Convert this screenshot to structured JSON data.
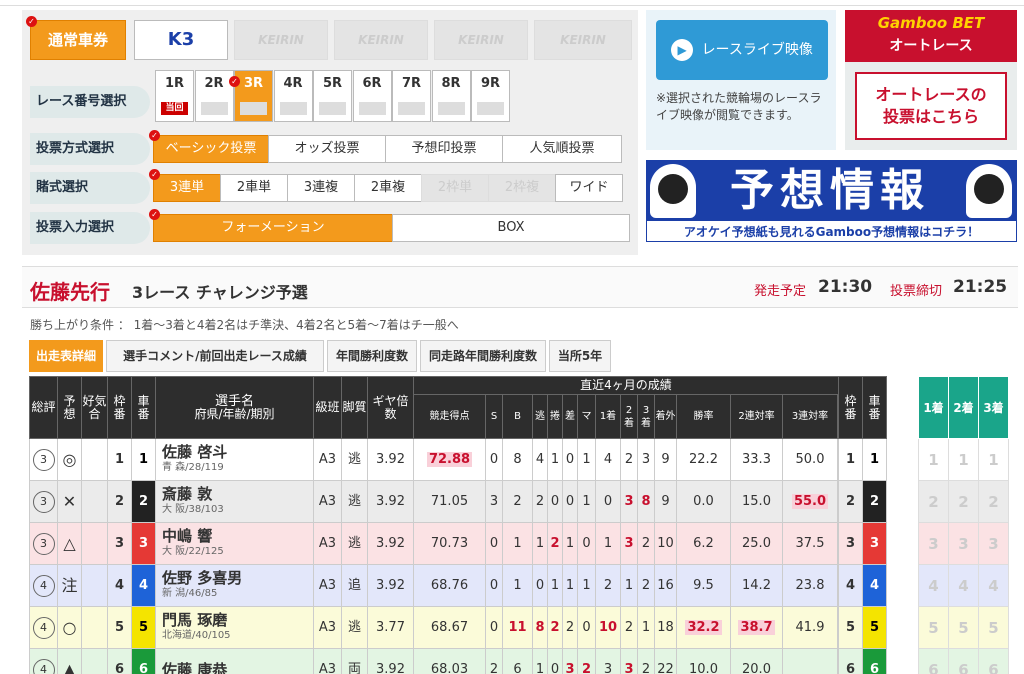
{
  "ticket_type": {
    "normal": "通常車券",
    "k3": "K3",
    "keirin": [
      "KEIRIN",
      "KEIRIN",
      "KEIRIN",
      "KEIRIN"
    ]
  },
  "rows": {
    "race_no": "レース番号選択",
    "vote_method": "投票方式選択",
    "bet_type": "賭式選択",
    "input_method": "投票入力選択"
  },
  "races": [
    {
      "label": "1R",
      "sub": "当回"
    },
    {
      "label": "2R",
      "sub": ""
    },
    {
      "label": "3R",
      "sub": ""
    },
    {
      "label": "4R",
      "sub": ""
    },
    {
      "label": "5R",
      "sub": ""
    },
    {
      "label": "6R",
      "sub": ""
    },
    {
      "label": "7R",
      "sub": ""
    },
    {
      "label": "8R",
      "sub": ""
    },
    {
      "label": "9R",
      "sub": ""
    }
  ],
  "vote_methods": [
    "ベーシック投票",
    "オッズ投票",
    "予想印投票",
    "人気順投票"
  ],
  "bet_types": [
    "3連単",
    "2車単",
    "3連複",
    "2車複",
    "2枠単",
    "2枠複",
    "ワイド"
  ],
  "input_methods": [
    "フォーメーション",
    "BOX"
  ],
  "live": {
    "button": "レースライブ映像",
    "note": "※選択された競輪場のレースライブ映像が閲覧できます。"
  },
  "autorace": {
    "brand": "Gamboo BET",
    "title": "オートレース",
    "cta_line1": "オートレースの",
    "cta_line2": "投票はこちら"
  },
  "yoso": {
    "title": "予想情報",
    "sub": "アオケイ予想紙も見れるGamboo予想情報はコチラ！"
  },
  "race": {
    "venue": "佐藤先行",
    "name": "3レース チャレンジ予選",
    "start_label": "発走予定",
    "start_time": "21:30",
    "close_label": "投票締切",
    "close_time": "21:25",
    "condition": "勝ち上がり条件 ： 1着〜3着と4着2名はチ準決、4着2名と5着〜7着はチ一般へ"
  },
  "tabs": [
    "出走表詳細",
    "選手コメント/前回出走レース成績",
    "年間勝利度数",
    "同走路年間勝利度数",
    "当所5年"
  ],
  "table_headers": {
    "sou": "総評",
    "yoso": "予想",
    "kouki": "好気合",
    "waku": "枠番",
    "sha": "車番",
    "name": "選手名",
    "name_sub": "府県/年齢/期別",
    "kyu": "級班",
    "kyaku": "脚質",
    "gear": "ギヤ倍数",
    "recent": "直近4ヶ月の成績",
    "score": "競走得点",
    "s": "S",
    "b": "B",
    "nige": "逃",
    "makuri": "捲",
    "sashi": "差",
    "ma": "マ",
    "c1": "1着",
    "c2": "2着",
    "c3": "3着",
    "out": "着外",
    "win": "勝率",
    "ren2": "2連対率",
    "ren3": "3連対率",
    "res1": "1着",
    "res2": "2着",
    "res3": "3着"
  },
  "riders": [
    {
      "sou": "3",
      "mark": "◎",
      "waku": "1",
      "sha": "1",
      "name": "佐藤 啓斗",
      "info": "青 森/28/119",
      "kyu": "A3",
      "kyaku": "逃",
      "gear": "3.92",
      "score": "72.88",
      "s": "0",
      "b": "8",
      "nige": "4",
      "makuri": "1",
      "sashi": "0",
      "ma": "1",
      "c1": "4",
      "c2": "2",
      "c3": "3",
      "out": "9",
      "win": "22.2",
      "ren2": "33.3",
      "ren3": "50.0",
      "row": "#ffffff",
      "shaBg": "#ffffff",
      "shaFg": "#000000"
    },
    {
      "sou": "3",
      "mark": "✕",
      "waku": "2",
      "sha": "2",
      "name": "斎藤 敦",
      "info": "大 阪/38/103",
      "kyu": "A3",
      "kyaku": "逃",
      "gear": "3.92",
      "score": "71.05",
      "s": "3",
      "b": "2",
      "nige": "2",
      "makuri": "0",
      "sashi": "0",
      "ma": "1",
      "c1": "0",
      "c2": "3",
      "c3": "8",
      "out": "9",
      "win": "0.0",
      "ren2": "15.0",
      "ren3": "55.0",
      "row": "#ebebeb",
      "shaBg": "#222222",
      "shaFg": "#ffffff"
    },
    {
      "sou": "3",
      "mark": "△",
      "waku": "3",
      "sha": "3",
      "name": "中嶋 響",
      "info": "大 阪/22/125",
      "kyu": "A3",
      "kyaku": "逃",
      "gear": "3.92",
      "score": "70.73",
      "s": "0",
      "b": "1",
      "nige": "1",
      "makuri": "2",
      "sashi": "1",
      "ma": "0",
      "c1": "1",
      "c2": "3",
      "c3": "2",
      "out": "10",
      "win": "6.2",
      "ren2": "25.0",
      "ren3": "37.5",
      "row": "#fbe2e4",
      "shaBg": "#e53935",
      "shaFg": "#ffffff"
    },
    {
      "sou": "4",
      "mark": "注",
      "waku": "4",
      "sha": "4",
      "name": "佐野 多喜男",
      "info": "新 潟/46/85",
      "kyu": "A3",
      "kyaku": "追",
      "gear": "3.92",
      "score": "68.76",
      "s": "0",
      "b": "1",
      "nige": "0",
      "makuri": "1",
      "sashi": "1",
      "ma": "1",
      "c1": "2",
      "c2": "1",
      "c3": "2",
      "out": "16",
      "win": "9.5",
      "ren2": "14.2",
      "ren3": "23.8",
      "row": "#e3e7fa",
      "shaBg": "#1e63d8",
      "shaFg": "#ffffff"
    },
    {
      "sou": "4",
      "mark": "○",
      "waku": "5",
      "sha": "5",
      "name": "門馬 琢磨",
      "info": "北海道/40/105",
      "kyu": "A3",
      "kyaku": "逃",
      "gear": "3.77",
      "score": "68.67",
      "s": "0",
      "b": "11",
      "nige": "8",
      "makuri": "2",
      "sashi": "2",
      "ma": "0",
      "c1": "10",
      "c2": "2",
      "c3": "1",
      "out": "18",
      "win": "32.2",
      "ren2": "38.7",
      "ren3": "41.9",
      "row": "#fbfbd9",
      "shaBg": "#f4e400",
      "shaFg": "#000000"
    },
    {
      "sou": "4",
      "mark": "▲",
      "waku": "6",
      "sha": "6",
      "name": "佐藤 康恭",
      "info": "",
      "kyu": "A3",
      "kyaku": "両",
      "gear": "3.92",
      "score": "68.03",
      "s": "2",
      "b": "6",
      "nige": "1",
      "makuri": "0",
      "sashi": "3",
      "ma": "2",
      "c1": "3",
      "c2": "3",
      "c3": "2",
      "out": "22",
      "win": "10.0",
      "ren2": "20.0",
      "ren3": "",
      "row": "#e3f5e3",
      "shaBg": "#1a9a3a",
      "shaFg": "#ffffff"
    }
  ],
  "colors": {
    "accent": "#f39a1c",
    "brand_red": "#c8102e",
    "live_blue": "#2f9ad6",
    "result_green": "#1aa58a",
    "yoso_blue": "#1b3fa8"
  },
  "icons": {
    "check": "check-badge-icon",
    "play": "play-icon"
  }
}
